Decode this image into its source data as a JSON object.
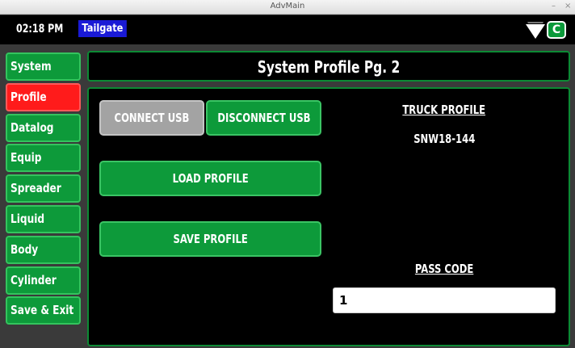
{
  "window": {
    "title": "AdvMain",
    "minimize": "–",
    "close": "×"
  },
  "status": {
    "time": "02:18 PM",
    "mode": "Tailgate",
    "connection_letter": "C"
  },
  "nav": {
    "items": [
      {
        "label": "System",
        "active": false
      },
      {
        "label": "Profile",
        "active": true
      },
      {
        "label": "Datalog",
        "active": false
      },
      {
        "label": "Equip",
        "active": false
      },
      {
        "label": "Spreader",
        "active": false
      },
      {
        "label": "Liquid",
        "active": false
      },
      {
        "label": "Body",
        "active": false
      },
      {
        "label": "Cylinder",
        "active": false
      },
      {
        "label": "Save & Exit",
        "active": false
      }
    ]
  },
  "page": {
    "title": "System Profile Pg. 2"
  },
  "profile": {
    "connect_usb": "CONNECT USB",
    "disconnect_usb": "DISCONNECT USB",
    "load_profile": "LOAD PROFILE",
    "save_profile": "SAVE PROFILE",
    "truck_profile_label": "TRUCK PROFILE",
    "truck_profile_value": "SNW18-144",
    "pass_code_label": "PASS CODE",
    "pass_code_value": "1"
  },
  "colors": {
    "button_green": "#0d9a3a",
    "active_red": "#ff1b1b",
    "disabled_gray": "#a3a3a3",
    "mode_blue": "#1a1ad6"
  },
  "icons": {
    "signal": "signal-strength-icon"
  }
}
